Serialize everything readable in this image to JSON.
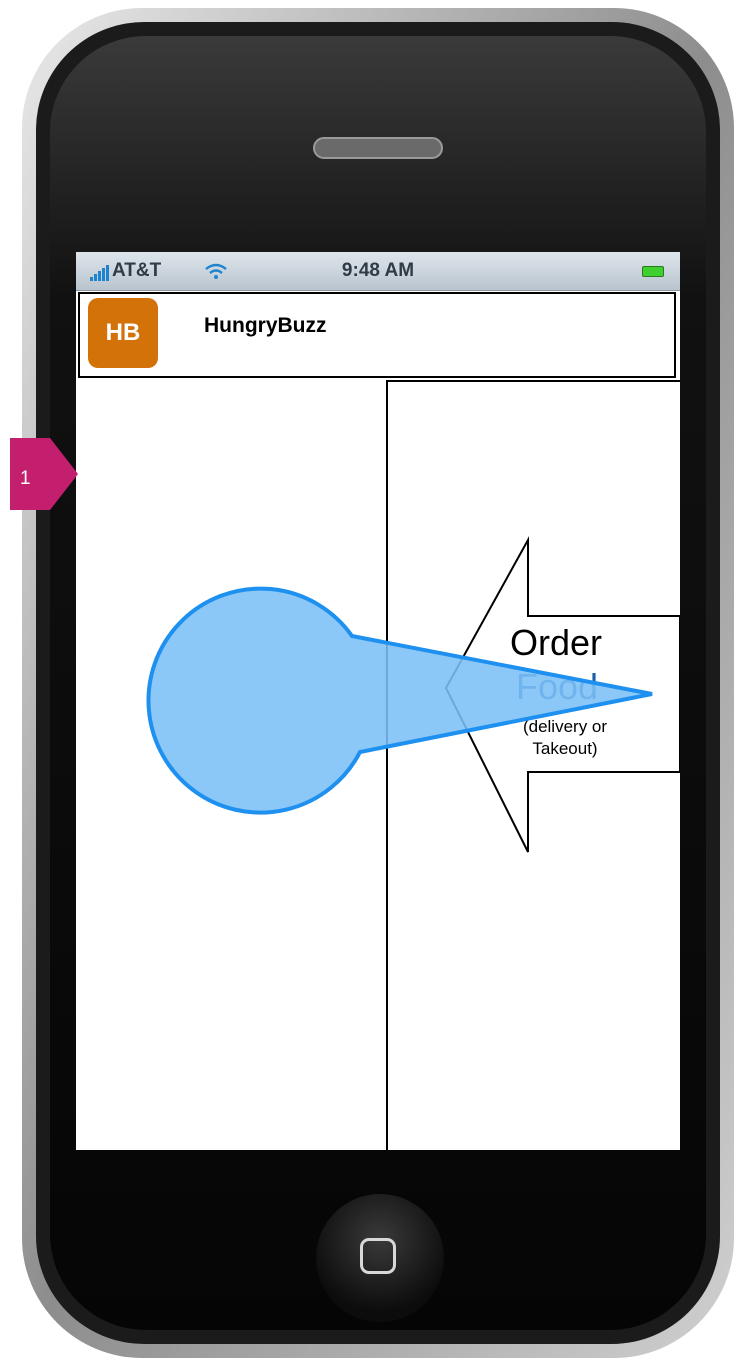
{
  "status_bar": {
    "carrier": "AT&T",
    "time": "9:48 AM"
  },
  "header": {
    "logo_text": "HB",
    "app_name": "HungryBuzz"
  },
  "main": {
    "action_title": "Order",
    "action_subject": "Food",
    "action_note_line1": "(delivery or",
    "action_note_line2": "Takeout)"
  },
  "annotation": {
    "marker_number": "1"
  },
  "colors": {
    "logo_bg": "#d4720a",
    "callout_fill": "#7cc0f6",
    "callout_stroke": "#1e90f0",
    "marker": "#c41f6e"
  },
  "icons": [
    "signal-bars-icon",
    "wifi-icon",
    "battery-icon",
    "home-button-icon"
  ]
}
